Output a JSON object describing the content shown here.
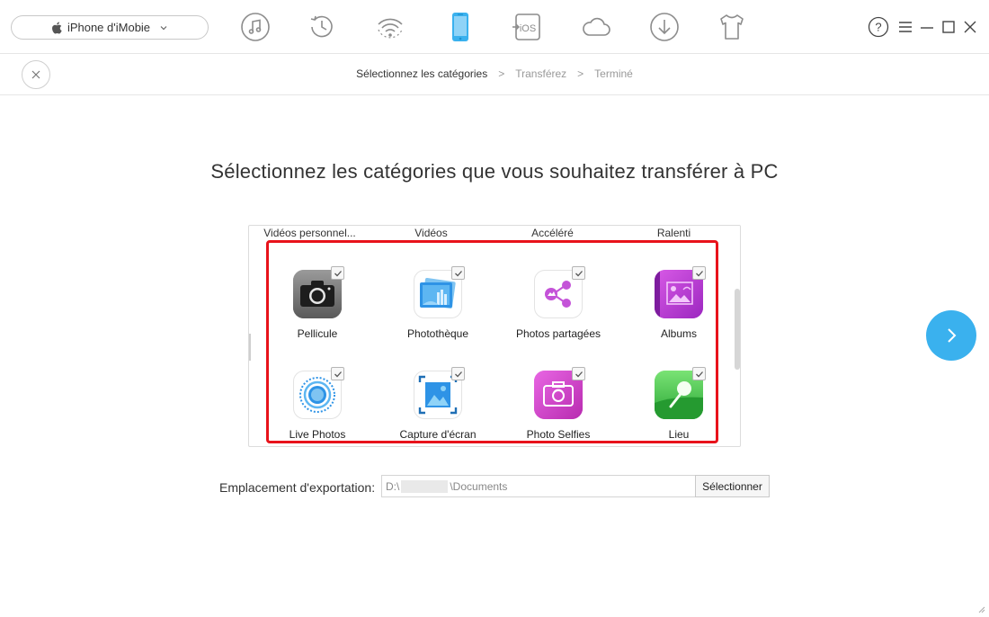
{
  "header": {
    "device_name": "iPhone d'iMobie",
    "toolbar_icons": [
      "music-note-icon",
      "history-clock-icon",
      "wifi-sync-icon",
      "phone-manager-icon",
      "ios-mover-icon",
      "icloud-icon",
      "download-icon",
      "tshirt-icon"
    ],
    "active_icon": "phone-manager-icon",
    "accent_color": "#3ab1ee",
    "icon_color": "#8c8c8c"
  },
  "window_controls": [
    "help-icon",
    "menu-icon",
    "minimize-icon",
    "maximize-icon",
    "close-icon"
  ],
  "steps": {
    "step1": "Sélectionnez les catégories",
    "sep1": ">",
    "step2": "Transférez",
    "sep2": ">",
    "step3": "Terminé"
  },
  "headline": "Sélectionnez les catégories que vous souhaitez transférer à PC",
  "panel": {
    "top_row": [
      "Vidéos personnel...",
      "Vidéos",
      "Accéléré",
      "Ralenti"
    ],
    "categories": [
      {
        "label": "Pellicule",
        "icon": "camera-icon",
        "checked": true
      },
      {
        "label": "Photothèque",
        "icon": "photo-library-icon",
        "checked": true
      },
      {
        "label": "Photos partagées",
        "icon": "shared-photos-icon",
        "checked": true
      },
      {
        "label": "Albums",
        "icon": "albums-icon",
        "checked": true
      },
      {
        "label": "Live Photos",
        "icon": "live-photos-icon",
        "checked": true
      },
      {
        "label": "Capture d'écran",
        "icon": "screenshot-icon",
        "checked": true
      },
      {
        "label": "Photo Selfies",
        "icon": "selfie-camera-icon",
        "checked": true
      },
      {
        "label": "Lieu",
        "icon": "location-pin-icon",
        "checked": true
      }
    ],
    "highlight_color": "#e8131b"
  },
  "export": {
    "label": "Emplacement d'exportation:",
    "path_prefix": "D:\\",
    "path_suffix": "\\Documents",
    "button_label": "Sélectionner"
  }
}
